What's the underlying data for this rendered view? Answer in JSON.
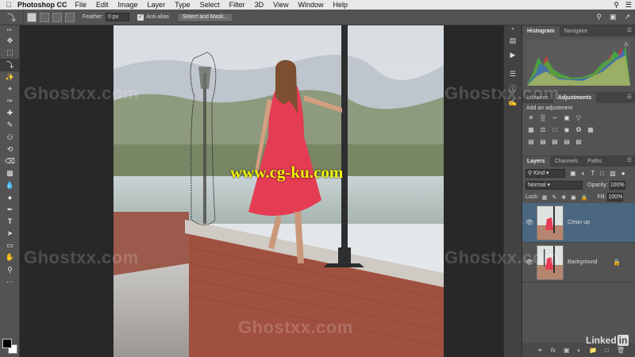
{
  "menubar": {
    "app": "Photoshop CC",
    "items": [
      "File",
      "Edit",
      "Image",
      "Layer",
      "Type",
      "Select",
      "Filter",
      "3D",
      "View",
      "Window",
      "Help"
    ],
    "right_icons": [
      "search-icon",
      "list-icon"
    ]
  },
  "options": {
    "feather_label": "Feather:",
    "feather_value": "0 px",
    "antialias_label": "Anti-alias",
    "select_mask_label": "Select and Mask..."
  },
  "histogram_panel": {
    "tabs": [
      "Histogram",
      "Navigator"
    ],
    "active_tab": "Histogram"
  },
  "adjustments_panel": {
    "tabs": [
      "Libraries",
      "Adjustments"
    ],
    "active_tab": "Adjustments",
    "title": "Add an adjustment"
  },
  "layers_panel": {
    "tabs": [
      "Layers",
      "Channels",
      "Paths"
    ],
    "active_tab": "Layers",
    "kind_label": "Kind",
    "blend_mode": "Normal",
    "opacity_label": "Opacity:",
    "opacity_value": "100%",
    "lock_label": "Lock:",
    "fill_label": "Fill:",
    "fill_value": "100%",
    "layers": [
      {
        "name": "Clean up",
        "selected": true,
        "visible": true
      },
      {
        "name": "Background",
        "selected": false,
        "visible": true,
        "locked": true
      }
    ]
  },
  "watermarks": {
    "ghost": "Ghostxx.com",
    "center": "www.cg-ku.com",
    "brand": "Linked",
    "brand_in": "in"
  }
}
